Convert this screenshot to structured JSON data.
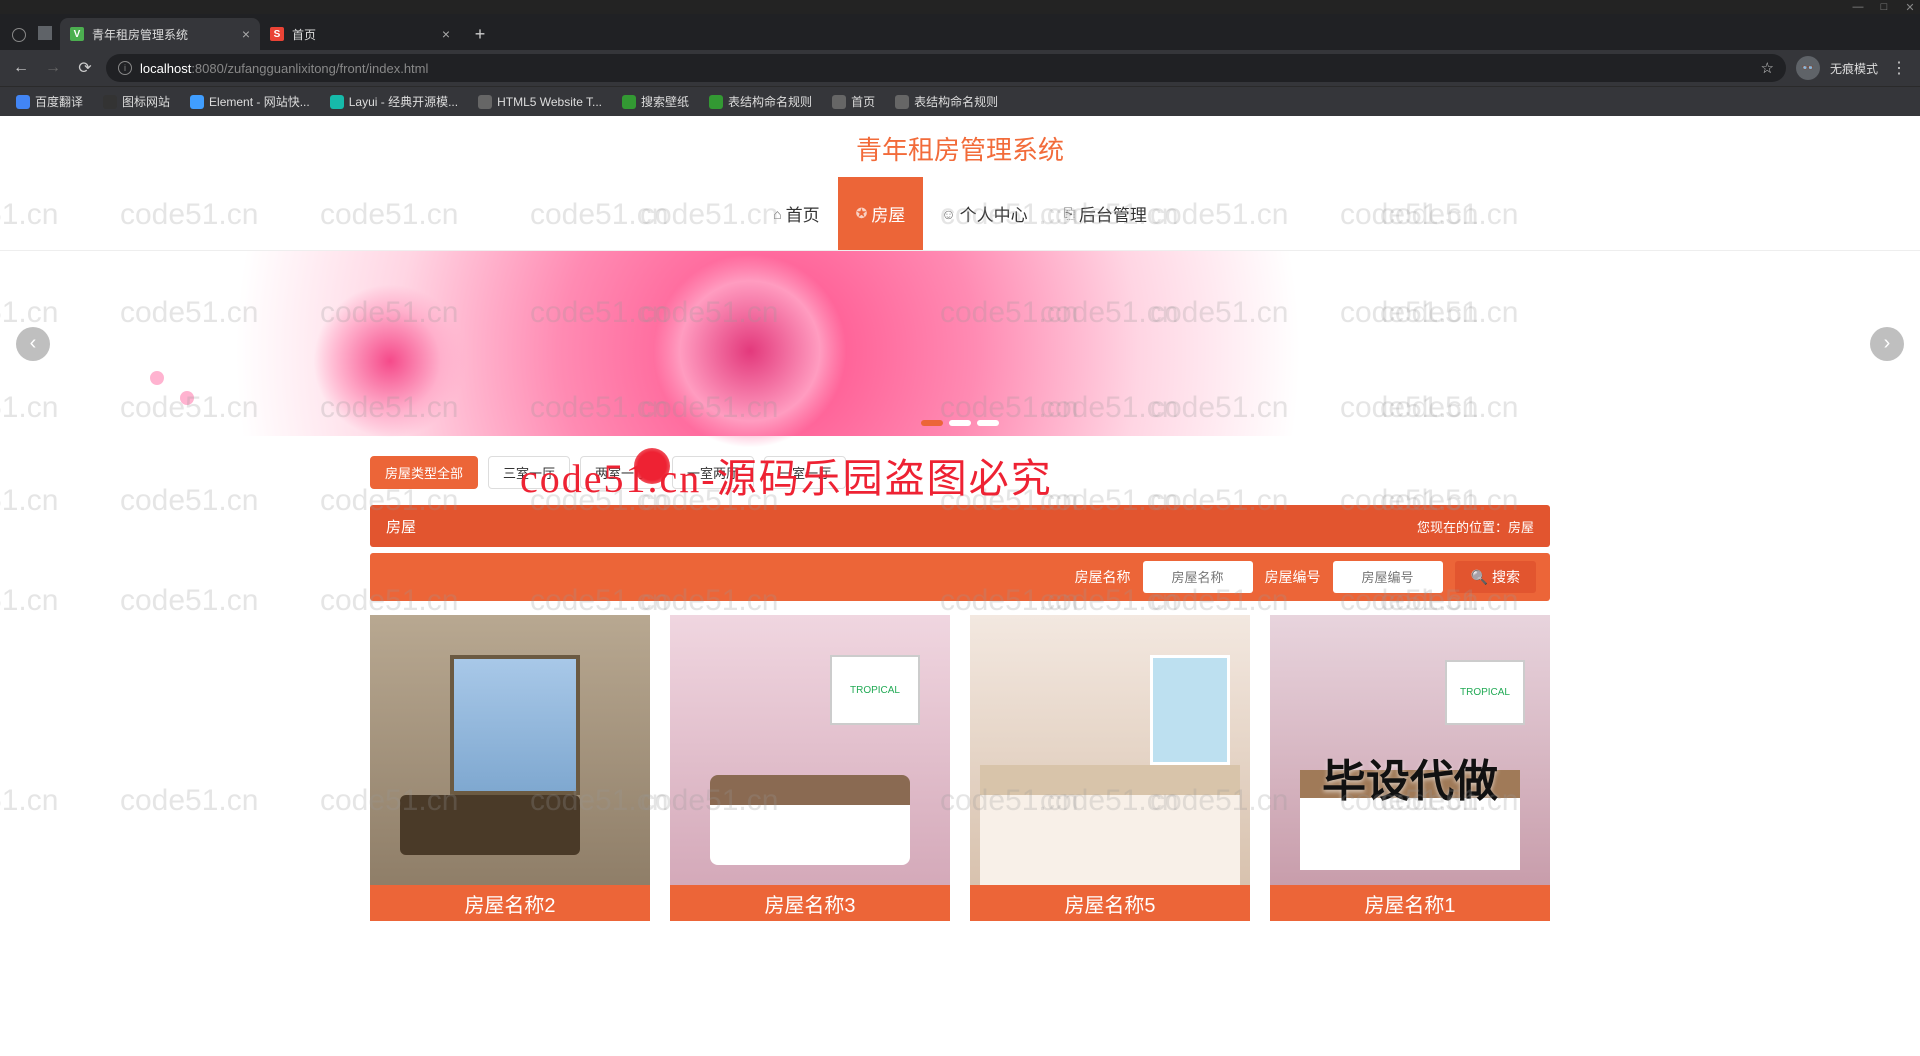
{
  "window": {
    "tabs": [
      {
        "title": "青年租房管理系统",
        "active": true,
        "favicon": "V"
      },
      {
        "title": "首页",
        "active": false,
        "favicon": "S"
      }
    ]
  },
  "address_bar": {
    "host": "localhost",
    "port": ":8080",
    "path": "/zufangguanlixitong/front/index.html",
    "profile_label": "无痕模式"
  },
  "bookmarks": [
    {
      "label": "百度翻译",
      "cls": "blue"
    },
    {
      "label": "图标网站",
      "cls": "dark"
    },
    {
      "label": "Element - 网站快...",
      "cls": "cyan"
    },
    {
      "label": "Layui - 经典开源模...",
      "cls": "teal"
    },
    {
      "label": "HTML5 Website T...",
      "cls": "gray"
    },
    {
      "label": "搜索壁纸",
      "cls": "green"
    },
    {
      "label": "表结构命名规则",
      "cls": "green"
    },
    {
      "label": "首页",
      "cls": "gray"
    },
    {
      "label": "表结构命名规则",
      "cls": "gray"
    }
  ],
  "site": {
    "title": "青年租房管理系统",
    "nav": [
      {
        "label": "首页",
        "icon": "⌂"
      },
      {
        "label": "房屋",
        "icon": "✪",
        "active": true
      },
      {
        "label": "个人中心",
        "icon": "☺"
      },
      {
        "label": "后台管理",
        "icon": "⎘"
      }
    ]
  },
  "filters": [
    {
      "label": "房屋类型全部",
      "active": true
    },
    {
      "label": "三室一厅"
    },
    {
      "label": "两室一厅"
    },
    {
      "label": "一室两厅"
    },
    {
      "label": "一室一厅"
    }
  ],
  "breadcrumb": {
    "section": "房屋",
    "location_label": "您现在的位置：",
    "location": "房屋"
  },
  "search": {
    "name_label": "房屋名称",
    "name_placeholder": "房屋名称",
    "code_label": "房屋编号",
    "code_placeholder": "房屋编号",
    "button": "搜索"
  },
  "cards": [
    {
      "title": "房屋名称2",
      "cls": "rm1"
    },
    {
      "title": "房屋名称3",
      "cls": "rm2",
      "poster": "TROPICAL"
    },
    {
      "title": "房屋名称5",
      "cls": "rm3"
    },
    {
      "title": "房屋名称1",
      "cls": "rm4",
      "poster": "TROPICAL",
      "overlay": "毕设代做"
    }
  ],
  "watermark_text": "code51.cn",
  "watermark_big": "code51.cn-源码乐园盗图必究"
}
